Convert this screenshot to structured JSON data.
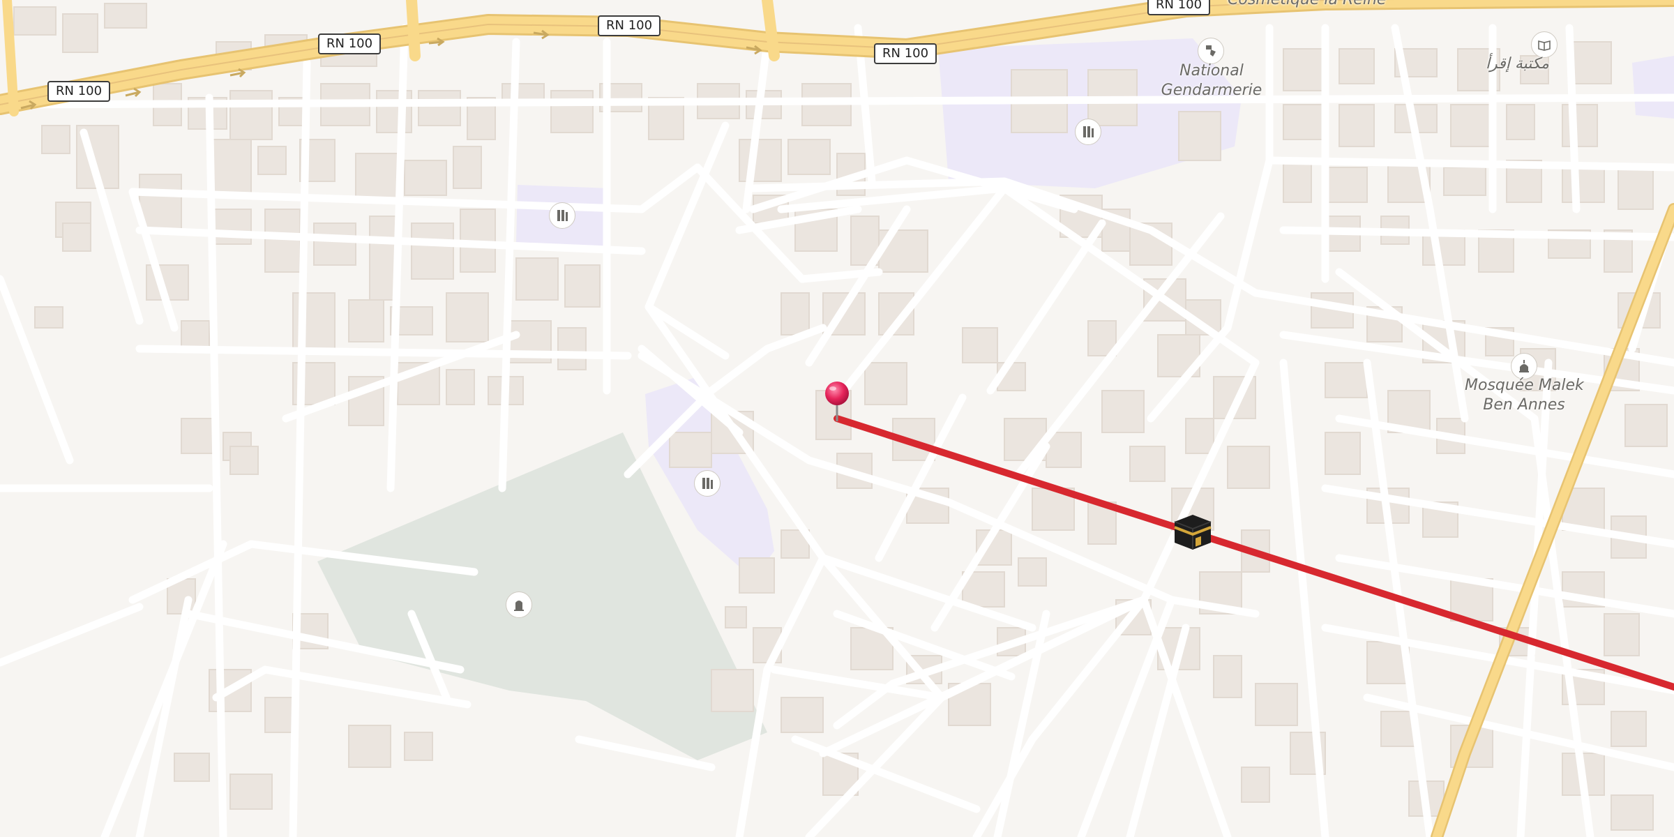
{
  "map": {
    "road_shields": [
      {
        "label": "RN 100"
      },
      {
        "label": "RN 100"
      },
      {
        "label": "RN 100"
      },
      {
        "label": "RN 100"
      },
      {
        "label": "RN 100"
      }
    ],
    "labels": {
      "national_gendarmerie_line1": "National",
      "national_gendarmerie_line2": "Gendarmerie",
      "mosque_line1": "Mosquée Malek",
      "mosque_line2": "Ben Annes",
      "library": "مكتبة إقرأ",
      "top_partial": "Cosmetique la Reine"
    },
    "icons": [
      "police-icon",
      "school-icon",
      "school-icon",
      "school-icon",
      "cemetery-icon",
      "mosque-icon",
      "library-icon",
      "location-pin-icon",
      "kaaba-icon"
    ],
    "colors": {
      "background": "#f7f5f2",
      "building": "#ebe5df",
      "road_major": "#f9d98a",
      "school_area": "#ece8f8",
      "cemetery_area": "#e0e5df",
      "qibla_line": "#d7282f",
      "pin": "#e6245a"
    }
  }
}
